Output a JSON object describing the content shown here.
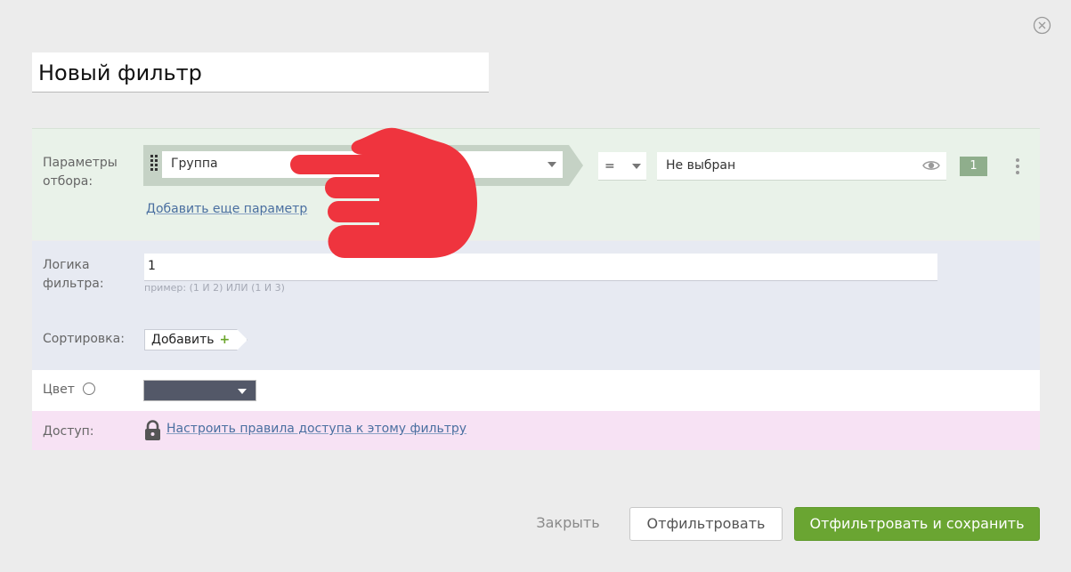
{
  "dialog": {
    "filter_name": "Новый фильтр"
  },
  "params": {
    "label": "Параметры отбора:",
    "field_value": "Группа",
    "operator_value": "=",
    "value_placeholder": "Не выбран",
    "badge": "1",
    "add_param_link": "Добавить еще параметр"
  },
  "logic": {
    "label": "Логика фильтра:",
    "value": "1",
    "hint": "пример: (1 И 2) ИЛИ (1 И 3)"
  },
  "sorting": {
    "label": "Сортировка:",
    "add_label": "Добавить",
    "plus_symbol": "+"
  },
  "color": {
    "label": "Цвет",
    "selected_color": "#535868"
  },
  "access": {
    "label": "Доступ:",
    "link": "Настроить правила доступа к этому фильтру"
  },
  "footer": {
    "close_label": "Закрыть",
    "filter_label": "Отфильтровать",
    "save_label": "Отфильтровать и сохранить"
  },
  "colors": {
    "accent_green": "#6aa532",
    "link_blue": "#4a6fa0",
    "hand_red": "#ef343e"
  },
  "icons": {
    "close": "close-circle-icon",
    "drag": "drag-handle-icon",
    "dropdown": "chevron-down-icon",
    "eye": "eye-icon",
    "kebab": "kebab-menu-icon",
    "lock": "lock-icon",
    "hand": "pointing-hand-icon"
  }
}
